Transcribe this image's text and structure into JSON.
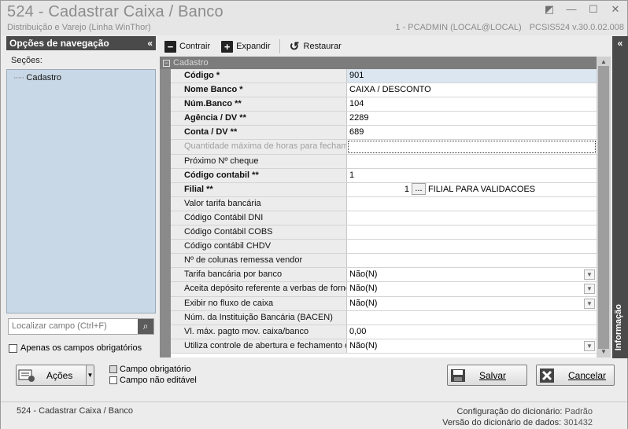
{
  "window": {
    "title": "524 - Cadastrar Caixa / Banco",
    "subtitle": "Distribuição e Varejo (Linha WinThor)",
    "connection": "1 - PCADMIN (LOCAL@LOCAL)",
    "version": "PCSIS524  v.30.0.02.008"
  },
  "nav": {
    "header": "Opções de navegação",
    "sections_label": "Seções:",
    "tree_items": [
      "Cadastro"
    ],
    "search_placeholder": "Localizar campo (Ctrl+F)",
    "only_required_label": "Apenas os campos obrigatórios"
  },
  "toolbar": {
    "collapse_label": "Contrair",
    "expand_label": "Expandir",
    "restore_label": "Restaurar"
  },
  "grid": {
    "category": "Cadastro",
    "rows": [
      {
        "label": "Código *",
        "value": "901"
      },
      {
        "label": "Nome Banco *",
        "value": "CAIXA / DESCONTO"
      },
      {
        "label": "Núm.Banco  **",
        "value": "104"
      },
      {
        "label": "Agência / DV  **",
        "value": "2289"
      },
      {
        "label": "Conta / DV  **",
        "value": "689"
      },
      {
        "label": "Quantidade máxima de horas para fechamento",
        "value": ""
      },
      {
        "label": "Próximo Nº cheque",
        "value": ""
      },
      {
        "label": "Código contabil **",
        "value": "1"
      },
      {
        "label": "Filial **",
        "value": "1",
        "desc": "FILIAL PARA VALIDACOES"
      },
      {
        "label": "Valor tarifa bancária",
        "value": ""
      },
      {
        "label": "Código Contábil DNI",
        "value": ""
      },
      {
        "label": "Código Contábil COBS",
        "value": ""
      },
      {
        "label": "Código contábil CHDV",
        "value": ""
      },
      {
        "label": "Nº de colunas remessa vendor",
        "value": ""
      },
      {
        "label": "Tarifa bancária por banco",
        "value": "Não(N)"
      },
      {
        "label": "Aceita depósito referente a verbas de fornecedor",
        "value": "Não(N)"
      },
      {
        "label": "Exibir no fluxo de caixa",
        "value": "Não(N)"
      },
      {
        "label": "Núm. da Instituição Bancária (BACEN)",
        "value": ""
      },
      {
        "label": "Vl. máx. pagto mov. caixa/banco",
        "value": "0,00"
      },
      {
        "label": "Utiliza controle de abertura e fechamento de caixa",
        "value": "Não(N)"
      }
    ],
    "ellipsis": "..."
  },
  "info_panel": {
    "label": "Informação"
  },
  "actions": {
    "acoes_label": "Ações",
    "legend_required": "Campo obrigatório",
    "legend_readonly": "Campo não editável",
    "save_label": "Salvar",
    "cancel_label": "Cancelar"
  },
  "statusbar": {
    "left": "524 - Cadastrar Caixa / Banco",
    "dict_config_label": "Configuração do dicionário:",
    "dict_config_value": "Padrão",
    "dict_version_label": "Versão do dicionário de dados:",
    "dict_version_value": "301432"
  },
  "colors": {
    "panel_dark": "#4a4a4a",
    "tree_bg": "#c9d8e6",
    "selected_value": "#dbe6f1"
  }
}
